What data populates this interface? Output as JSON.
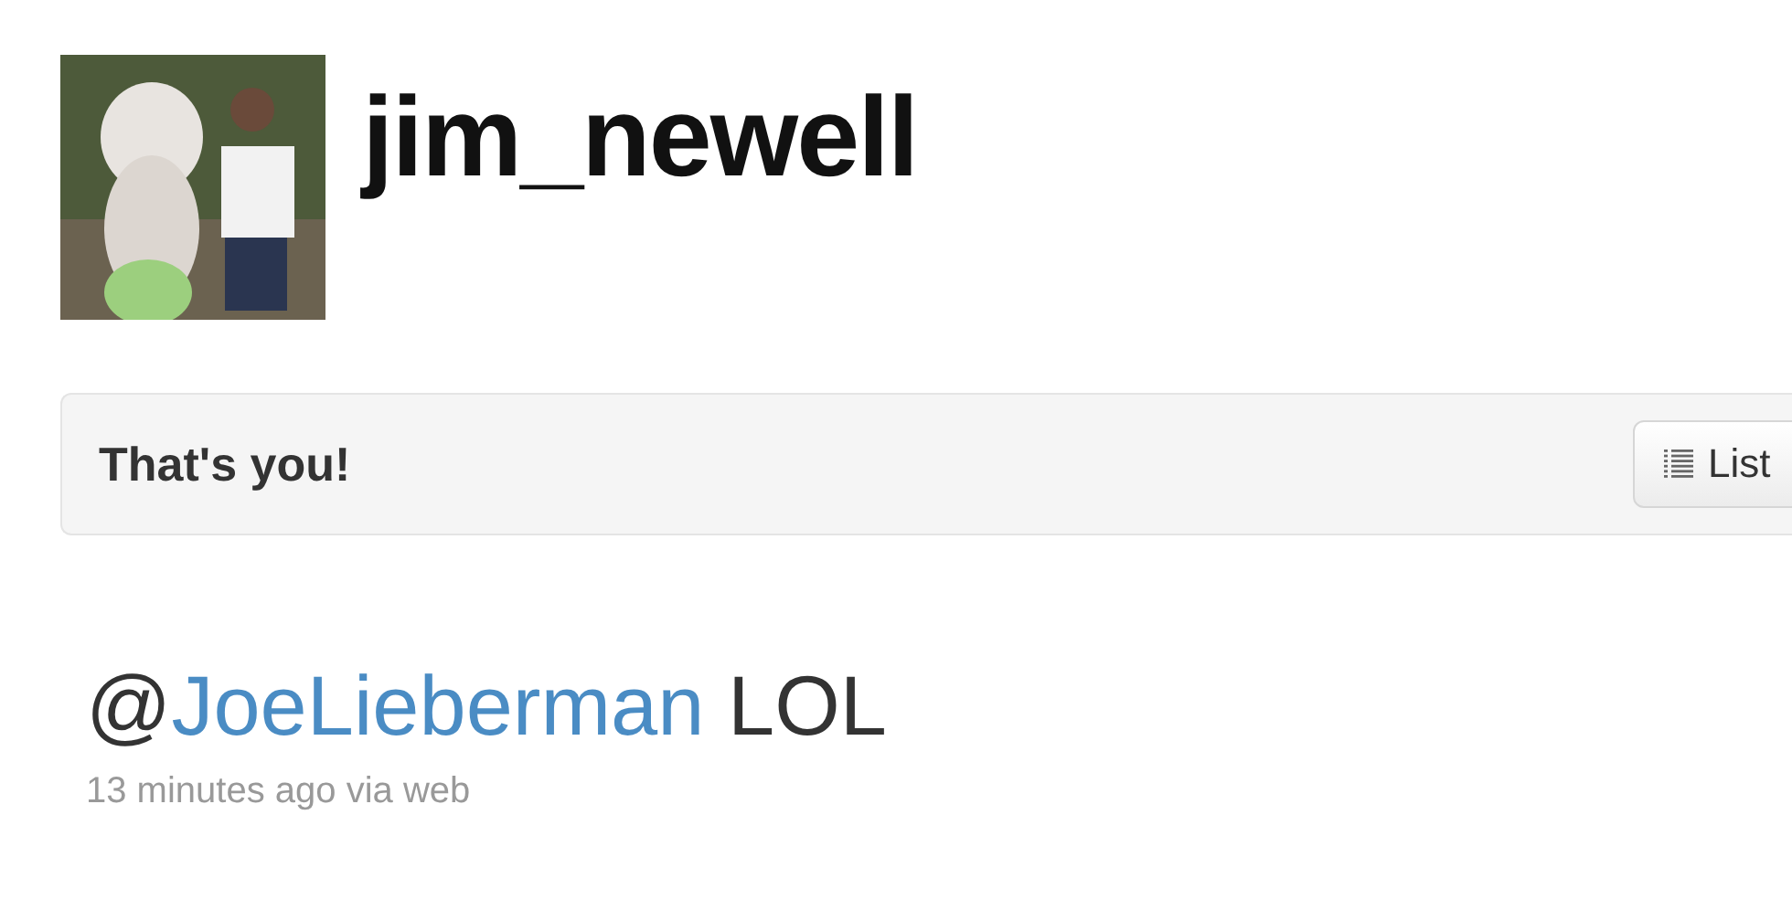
{
  "profile": {
    "username": "jim_newell"
  },
  "banner": {
    "text": "That's you!",
    "button": {
      "label": "List"
    }
  },
  "tweet": {
    "parts": [
      {
        "kind": "text",
        "text": "@"
      },
      {
        "kind": "mention",
        "text": "JoeLieberman"
      },
      {
        "kind": "text",
        "text": " LOL"
      }
    ],
    "meta": "13 minutes ago via web"
  }
}
